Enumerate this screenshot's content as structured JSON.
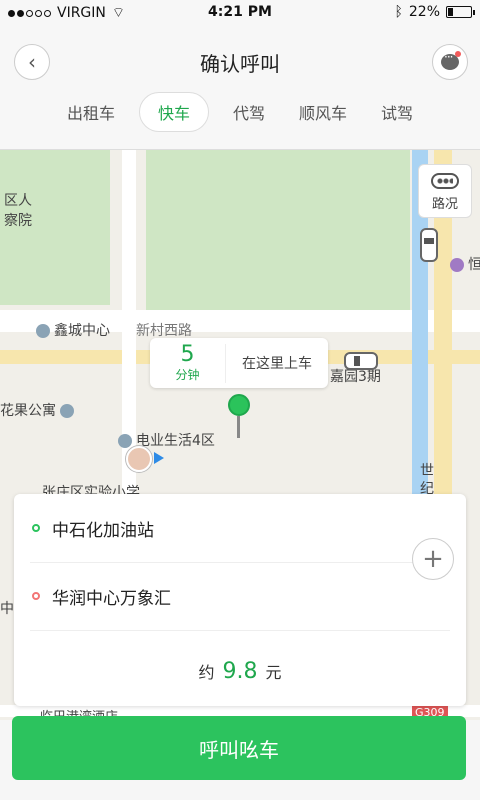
{
  "status_bar": {
    "carrier": "VIRGIN",
    "time": "4:21 PM",
    "battery": "22%"
  },
  "header": {
    "title": "确认呼叫",
    "tabs": [
      {
        "label": "出租车",
        "active": false
      },
      {
        "label": "快车",
        "active": true
      },
      {
        "label": "代驾",
        "active": false
      },
      {
        "label": "顺风车",
        "active": false
      },
      {
        "label": "试驾",
        "active": false
      }
    ]
  },
  "map": {
    "traffic_label": "路况",
    "eta": {
      "minutes": "5",
      "unit": "分钟",
      "text": "在这里上车"
    },
    "labels": [
      "鑫城中心",
      "新村西路",
      "嘉园3期",
      "花果公寓",
      "电业生活4区",
      "张庄区实验小学",
      "区人",
      "察院",
      "世",
      "纪",
      "临巴港湾酒店",
      "G309",
      "中国",
      "恒"
    ]
  },
  "trip": {
    "from": "中石化加油站",
    "to": "华润中心万象汇",
    "price_prefix": "约",
    "price_value": "9.8",
    "price_unit": "元"
  },
  "action": {
    "call_label": "呼叫吆车"
  },
  "colors": {
    "accent": "#2cc35e",
    "from_dot": "#2cc35e",
    "to_dot": "#f27575"
  }
}
